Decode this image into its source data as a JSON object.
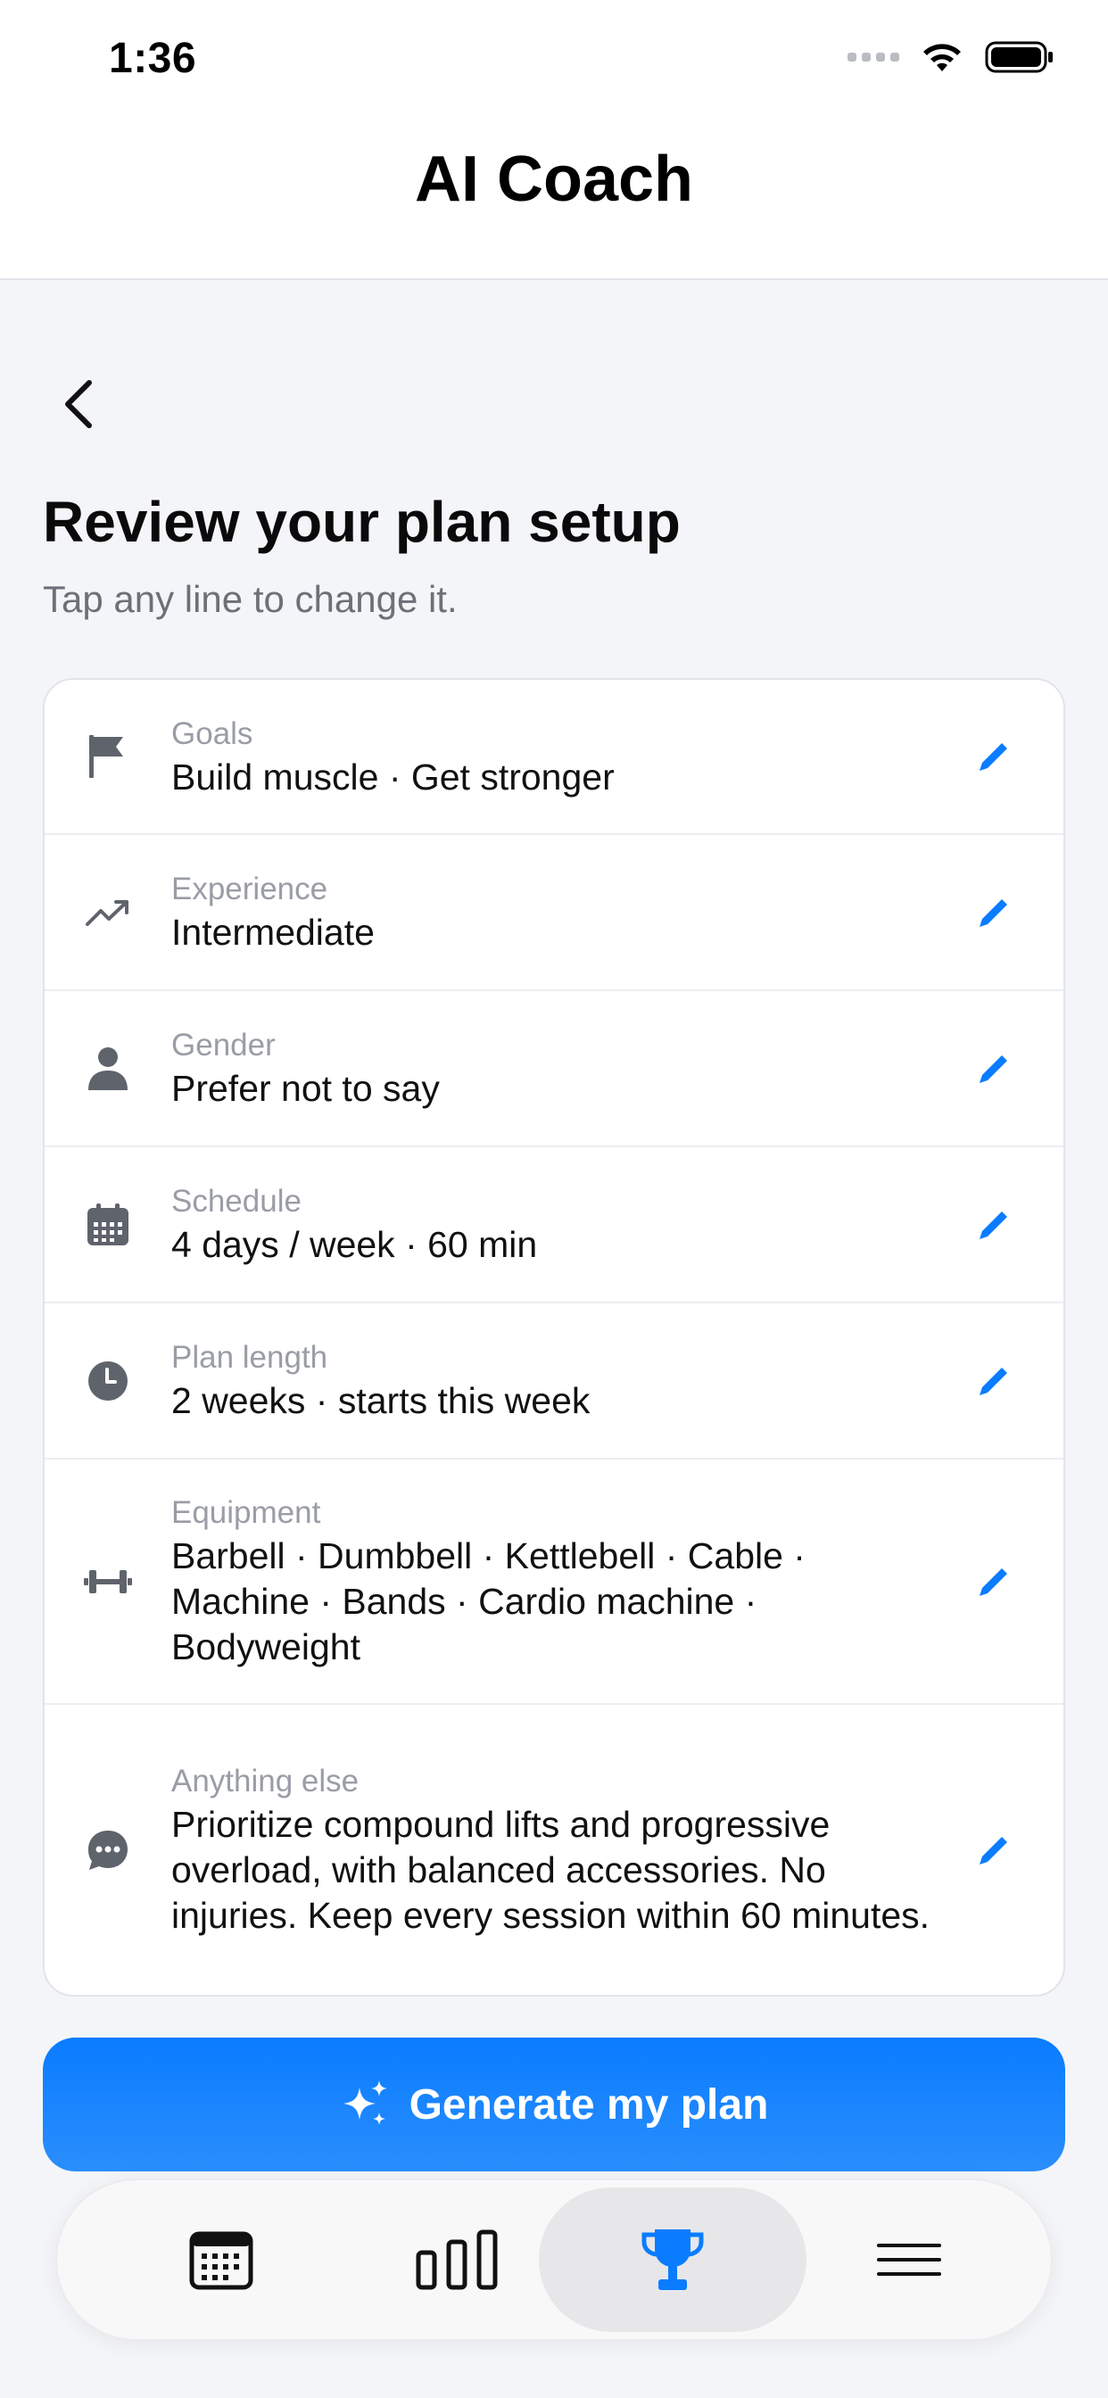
{
  "status_bar": {
    "time": "1:36"
  },
  "header": {
    "title": "AI Coach"
  },
  "page": {
    "title": "Review your plan setup",
    "subtitle": "Tap any line to change it."
  },
  "rows": [
    {
      "icon": "flag-icon",
      "label": "Goals",
      "value": "Build muscle · Get stronger"
    },
    {
      "icon": "trending-up-icon",
      "label": "Experience",
      "value": "Intermediate"
    },
    {
      "icon": "person-icon",
      "label": "Gender",
      "value": "Prefer not to say"
    },
    {
      "icon": "calendar-icon",
      "label": "Schedule",
      "value": "4 days / week · 60 min"
    },
    {
      "icon": "clock-icon",
      "label": "Plan length",
      "value": "2 weeks · starts this week"
    },
    {
      "icon": "dumbbell-icon",
      "label": "Equipment",
      "value": "Barbell · Dumbbell · Kettlebell · Cable · Machine · Bands · Cardio machine · Bodyweight"
    },
    {
      "icon": "chat-bubble-icon",
      "label": "Anything else",
      "value": "Prioritize compound lifts and progressive overload, with balanced accessories. No injuries. Keep every session within 60 minutes."
    }
  ],
  "generate_button": {
    "label": "Generate my plan"
  },
  "tab_bar": {
    "active": "trophy",
    "tabs": [
      "calendar",
      "stats",
      "trophy",
      "menu"
    ]
  },
  "colors": {
    "accent": "#0a7cff",
    "icon_gray": "#5f636c"
  }
}
